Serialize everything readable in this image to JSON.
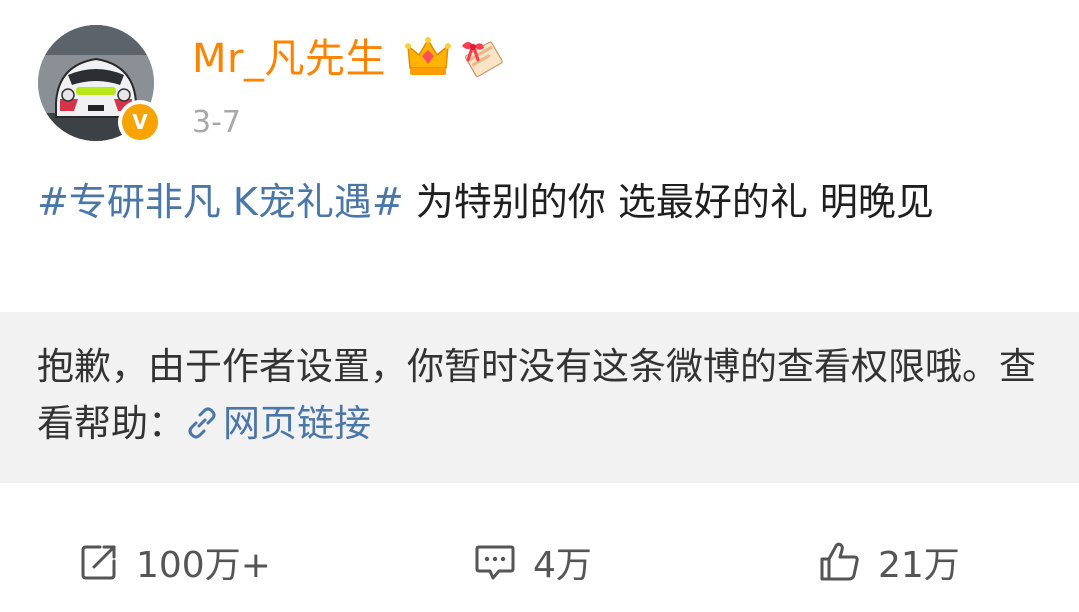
{
  "user": {
    "name": "Mr_凡先生",
    "time": "3-7",
    "avatar_icon": "car-avatar",
    "badge_icon": "verified-v-icon",
    "badge_letter": "V",
    "badge_color": "#f7a400",
    "name_color": "#ff8200",
    "member_icon": "crown-icon",
    "gift_icon": "gift-icon"
  },
  "post": {
    "hashtag": "#专研非凡 K宠礼遇#",
    "text": " 为特别的你 选最好的礼 明晚见",
    "link_color": "#4a76a8"
  },
  "notice": {
    "message": "抱歉，由于作者设置，你暂时没有这条微博的查看权限哦。查看帮助：",
    "link_icon": "link-icon",
    "link_label": "网页链接"
  },
  "actions": {
    "repost": {
      "icon": "repost-icon",
      "count": "100万+"
    },
    "comment": {
      "icon": "comment-icon",
      "count": "4万"
    },
    "like": {
      "icon": "like-icon",
      "count": "21万"
    }
  }
}
